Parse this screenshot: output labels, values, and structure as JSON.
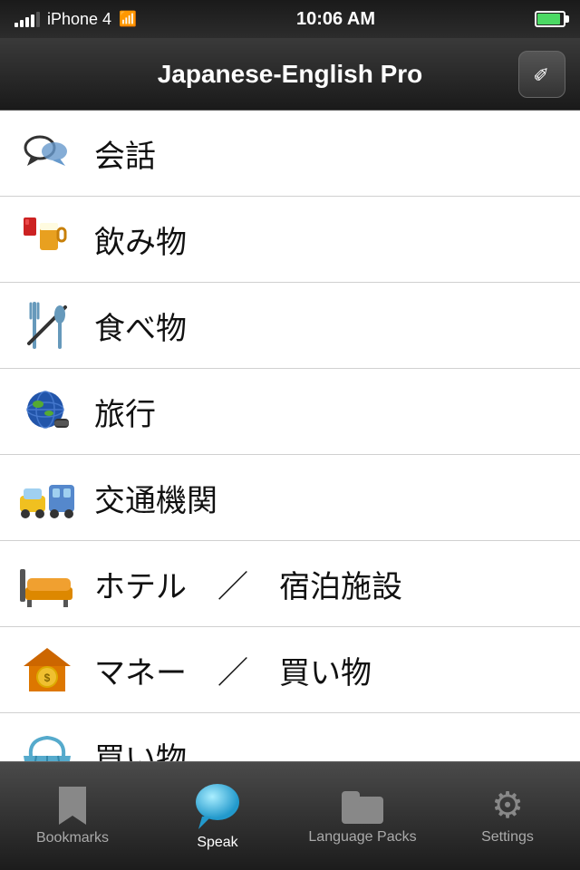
{
  "statusBar": {
    "carrier": "iPhone 4",
    "time": "10:06 AM"
  },
  "header": {
    "title": "Japanese-English Pro",
    "editButton": "✎"
  },
  "listItems": [
    {
      "id": 1,
      "label": "会話",
      "icon": "💬"
    },
    {
      "id": 2,
      "label": "飲み物",
      "icon": "🍺"
    },
    {
      "id": 3,
      "label": "食べ物",
      "icon": "🍴"
    },
    {
      "id": 4,
      "label": "旅行",
      "icon": "🌍"
    },
    {
      "id": 5,
      "label": "交通機関",
      "icon": "🚕"
    },
    {
      "id": 6,
      "label": "ホテル　／　宿泊施設",
      "icon": "🛏"
    },
    {
      "id": 7,
      "label": "マネー　／　買い物",
      "icon": "🏠"
    },
    {
      "id": 8,
      "label": "買い物",
      "icon": "🧺"
    },
    {
      "id": 9,
      "label": "…",
      "icon": "🌿"
    }
  ],
  "tabBar": {
    "tabs": [
      {
        "id": "bookmarks",
        "label": "Bookmarks",
        "active": false
      },
      {
        "id": "speak",
        "label": "Speak",
        "active": true
      },
      {
        "id": "language-packs",
        "label": "Language Packs",
        "active": false
      },
      {
        "id": "settings",
        "label": "Settings",
        "active": false
      }
    ]
  }
}
